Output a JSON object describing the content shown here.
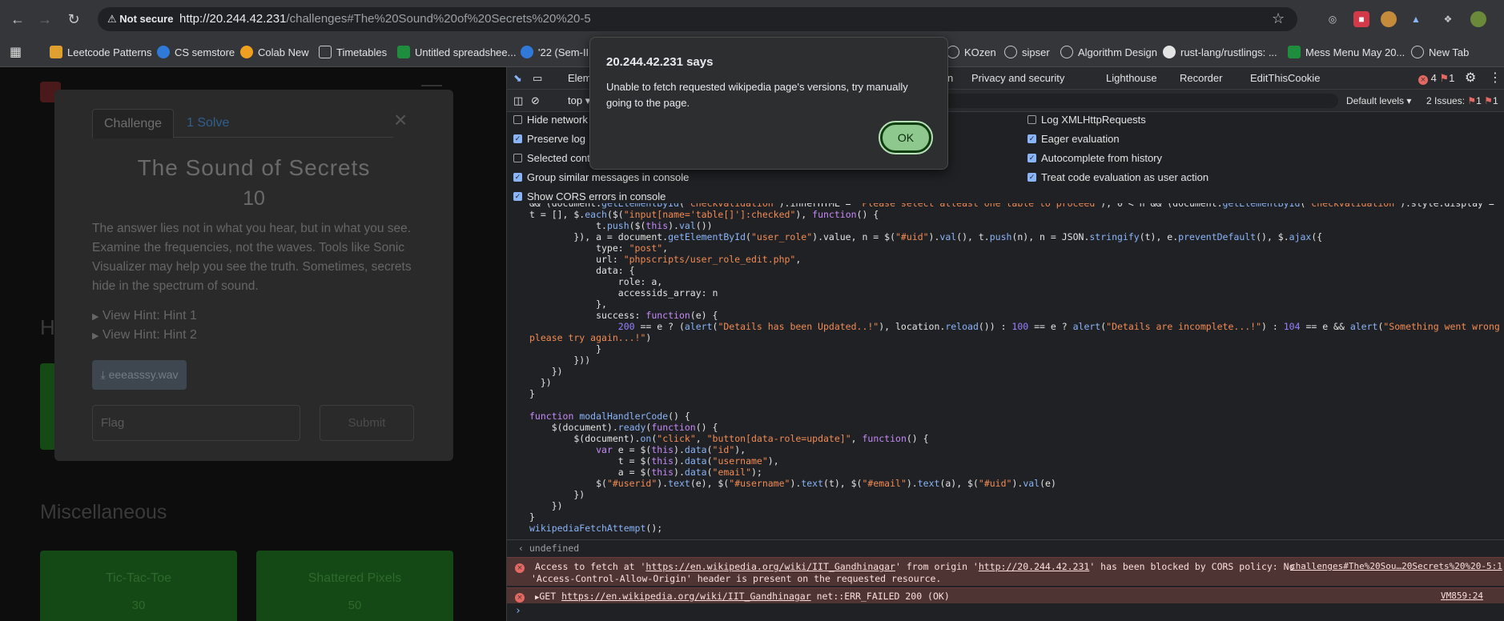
{
  "browser": {
    "not_secure": "Not secure",
    "url_host": "http://20.244.42.231",
    "url_path": "/challenges#The%20Sound%20of%20Secrets%20%20-5",
    "bookmarks": [
      "Leetcode Patterns",
      "CS semstore",
      "Colab New",
      "Timetables",
      "Untitled spreadshee...",
      "'22 (Sem-II 2",
      "KOzen",
      "sipser",
      "Algorithm Design",
      "rust-lang/rustlings: ...",
      "Mess Menu May 20...",
      "New Tab"
    ]
  },
  "page": {
    "section_heading_partial": "H",
    "misc_heading": "Miscellaneous",
    "cards": [
      {
        "name": "Tic-Tac-Toe",
        "points": "30"
      },
      {
        "name": "Shattered Pixels",
        "points": "50"
      }
    ]
  },
  "modal": {
    "tab_challenge": "Challenge",
    "tab_solves": "1 Solve",
    "close": "×",
    "title": "The Sound of Secrets",
    "value": "10",
    "description": "The answer lies not in what you hear, but in what you see. Examine the frequencies, not the waves. Tools like Sonic Visualizer may help you see the truth. Sometimes, secrets hide in the spectrum of sound.",
    "hint1": "View Hint: Hint 1",
    "hint2": "View Hint: Hint 2",
    "download": "eeeasssy.wav",
    "flag_placeholder": "Flag",
    "submit": "Submit"
  },
  "devtools": {
    "tab_elements": "Elem",
    "tabs_right": [
      "n",
      "Privacy and security",
      "Lighthouse",
      "Recorder",
      "EditThisCookie"
    ],
    "error_count": "4",
    "warn_count": "1",
    "context": "top",
    "default_levels": "Default levels",
    "issues": "2 Issues:",
    "issue_err": "1",
    "issue_warn": "1",
    "options_left": [
      {
        "label": "Hide network",
        "checked": false
      },
      {
        "label": "Preserve log",
        "checked": true
      },
      {
        "label": "Selected conte",
        "checked": false
      },
      {
        "label": "Group similar messages in console",
        "checked": true
      },
      {
        "label": "Show CORS errors in console",
        "checked": true
      }
    ],
    "options_right": [
      {
        "label": "Log XMLHttpRequests",
        "checked": false
      },
      {
        "label": "Eager evaluation",
        "checked": true
      },
      {
        "label": "Autocomplete from history",
        "checked": true
      },
      {
        "label": "Treat code evaluation as user action",
        "checked": true
      }
    ],
    "undefined": "undefined",
    "error1": {
      "pre": "Access to fetch at '",
      "url1": "https://en.wikipedia.org/wiki/IIT_Gandhinagar",
      "mid": "' from origin '",
      "url2": "http://20.244.42.231",
      "post": "' has been blocked by CORS policy: No",
      "line2": "'Access-Control-Allow-Origin' header is present on the requested resource.",
      "source": "challenges#The%20Sou…20Secrets%20%20-5:1"
    },
    "error2": {
      "method": "GET",
      "url": "https://en.wikipedia.org/wiki/IIT_Gandhinagar",
      "status": "net::ERR_FAILED 200 (OK)",
      "source": "VM859:24"
    }
  },
  "alert": {
    "title": "20.244.42.231 says",
    "message": "Unable to fetch requested wikipedia page's versions, try manually going to the page.",
    "ok": "OK"
  }
}
